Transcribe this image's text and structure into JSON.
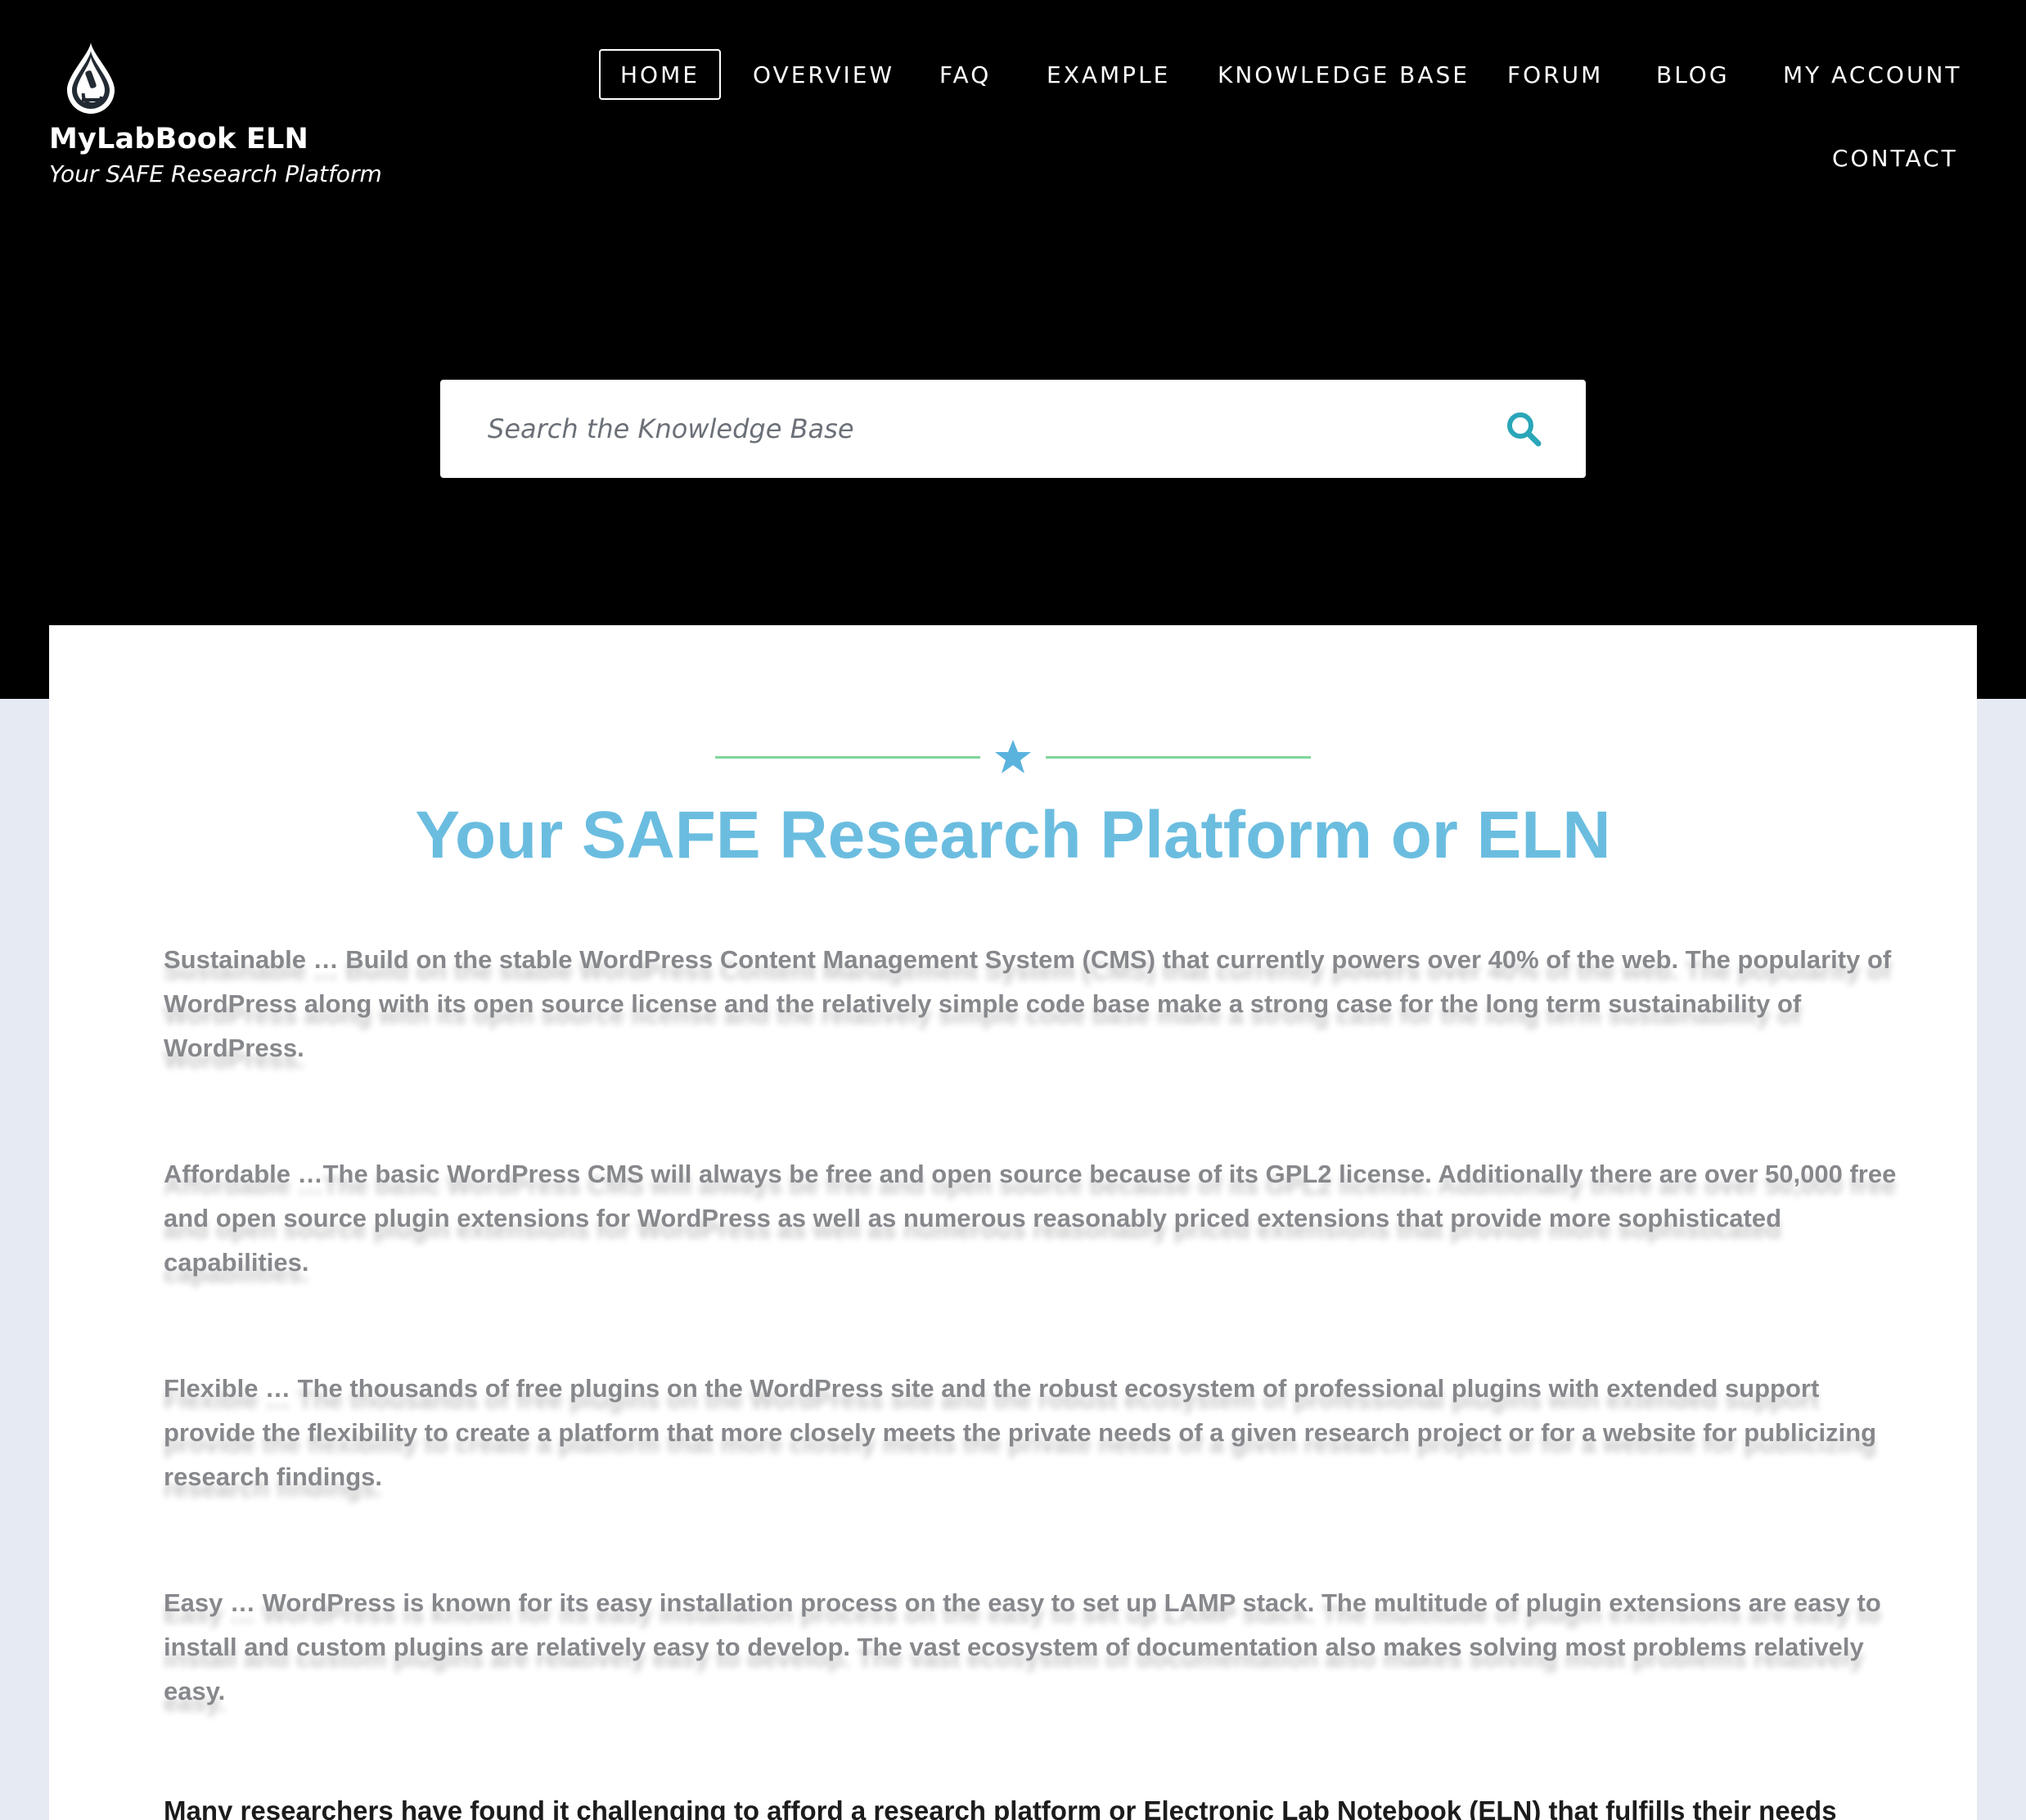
{
  "site": {
    "title": "MyLabBook ELN",
    "tagline": "Your SAFE Research Platform"
  },
  "nav": {
    "items": [
      {
        "label": "HOME",
        "active": true
      },
      {
        "label": "OVERVIEW"
      },
      {
        "label": "FAQ"
      },
      {
        "label": "EXAMPLE"
      },
      {
        "label": "KNOWLEDGE BASE"
      },
      {
        "label": "FORUM"
      },
      {
        "label": "BLOG"
      },
      {
        "label": "MY ACCOUNT"
      },
      {
        "label": "CONTACT"
      }
    ]
  },
  "search": {
    "placeholder": "Search the Knowledge Base",
    "icon": "search-icon"
  },
  "main": {
    "heading": "Your SAFE Research Platform or ELN",
    "divider_icon": "star-icon",
    "paragraphs": [
      "Sustainable … Build on the stable WordPress Content Management System (CMS) that currently powers over 40% of the web. The popularity of WordPress along with its open source license and the relatively simple code base make a strong case for the long term sustainability of WordPress.",
      "Affordable …The basic WordPress CMS will always be free and open source because of its GPL2 license. Additionally there are over 50,000 free and open source plugin extensions for WordPress as well as numerous reasonably priced extensions that provide more sophisticated capabilities.",
      "Flexible … The thousands of free plugins on the WordPress site and the robust ecosystem of professional plugins with extended support provide the flexibility to create a platform that more closely meets the private needs of a given research project or for a website for publicizing research findings.",
      "Easy … WordPress is known for its easy installation process on the easy to set up LAMP stack. The multitude of plugin extensions are easy to install and custom plugins are relatively easy to develop. The vast ecosystem of documentation also makes solving most problems relatively easy."
    ],
    "closing": "Many researchers have found it challenging to afford a research platform or Electronic Lab Notebook (ELN) that fulfills their needs"
  },
  "colors": {
    "header_bg": "#000000",
    "page_bg": "#e6eaf2",
    "heading": "#6bbde0",
    "divider_line": "#7fd69b",
    "star": "#5ab3dd",
    "search_icon": "#2aa6b8"
  }
}
